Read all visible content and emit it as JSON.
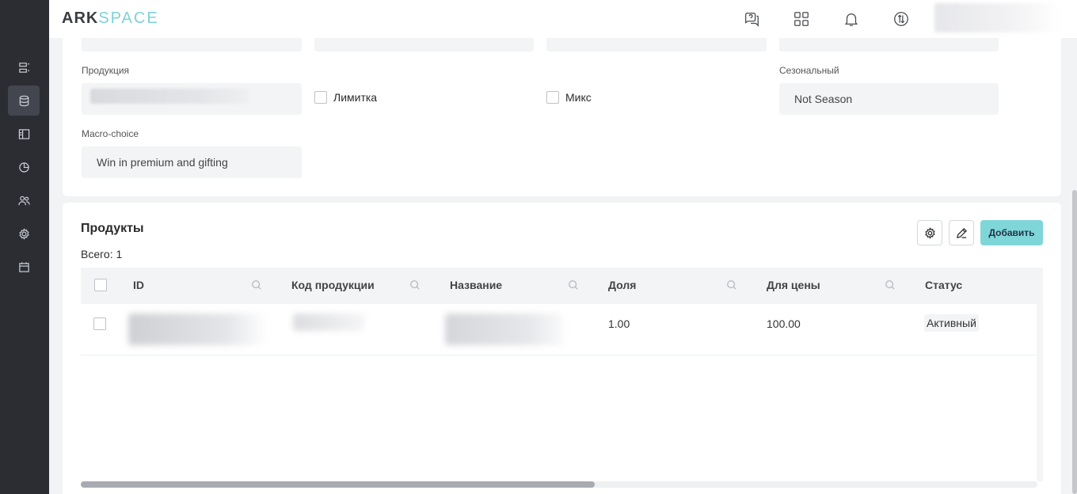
{
  "header": {
    "logo_part1": "ARK",
    "logo_part2": "SPACE",
    "icons": [
      "help-chat-icon",
      "apps-grid-icon",
      "bell-icon",
      "sync-icon"
    ]
  },
  "sidebar": {
    "items": [
      "list-icon",
      "database-icon",
      "layout-icon",
      "pie-chart-icon",
      "users-icon",
      "gear-icon",
      "calendar-icon"
    ],
    "active_index": 1
  },
  "form": {
    "product_label": "Продукция",
    "limit_label": "Лимитка",
    "mix_label": "Микс",
    "seasonal_label": "Сезональный",
    "seasonal_value": "Not Season",
    "macro_label": "Macro-choice",
    "macro_value": "Win in premium and gifting"
  },
  "products": {
    "title": "Продукты",
    "total": "Всего: 1",
    "add_label": "Добавить",
    "columns": [
      "ID",
      "Код продукции",
      "Название",
      "Доля",
      "Для цены",
      "Статус"
    ],
    "rows": [
      {
        "id": "",
        "code": "",
        "name": "",
        "share": "1.00",
        "price": "100.00",
        "status": "Активный"
      }
    ]
  },
  "colors": {
    "accent": "#7fd6d9",
    "sidebar": "#2b2d33"
  }
}
